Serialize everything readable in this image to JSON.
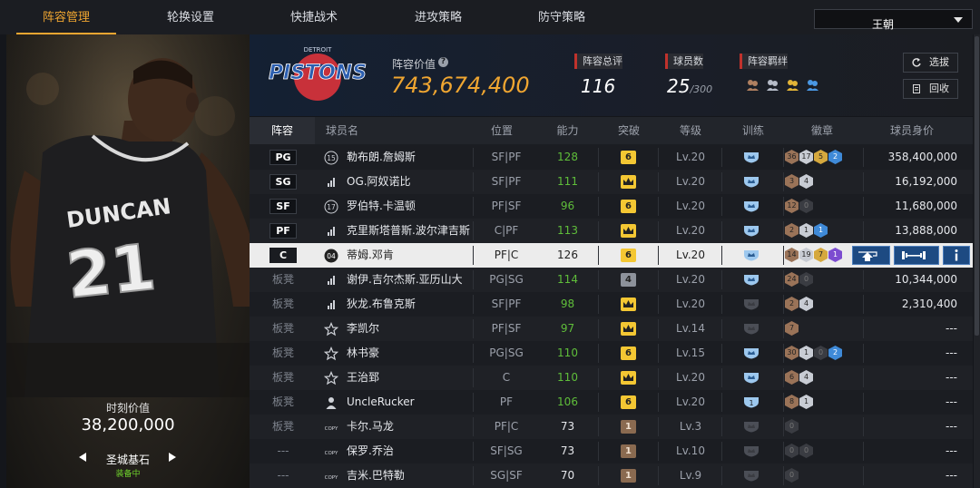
{
  "tabs": [
    "阵容管理",
    "轮换设置",
    "快捷战术",
    "进攻策略",
    "防守策略"
  ],
  "team_select": "王朝",
  "player_card": {
    "jersey_name": "DUNCAN",
    "jersey_number": "21",
    "moment_label": "时刻价值",
    "moment_value": "38,200,000",
    "card_name": "圣城基石",
    "card_status": "装备中"
  },
  "summary": {
    "team_logo_text": "PISTONS",
    "lineup_value_label": "阵容价值",
    "lineup_value": "743,674,400",
    "overall_label": "阵容总评",
    "overall_value": "116",
    "player_count_label": "球员数",
    "player_count": "25",
    "player_count_max": "/300",
    "bonds_label": "阵容羁绊",
    "scout_button": "选拔",
    "recycle_button": "回收"
  },
  "table": {
    "headers": [
      "阵容",
      "球员名",
      "位置",
      "能力",
      "突破",
      "等级",
      "训练",
      "徽章",
      "球员身价"
    ],
    "rows": [
      {
        "slot": "PG",
        "starter": true,
        "icon": "15",
        "name": "勒布朗.詹姆斯",
        "pos": "SF|PF",
        "ability": "128",
        "breakthrough": "6",
        "brk_type": "y",
        "level": "Lv.20",
        "train": "blue",
        "badges": [
          [
            "36",
            "br"
          ],
          [
            "17",
            "sv"
          ],
          [
            "5",
            "gd"
          ],
          [
            "2",
            "bl"
          ]
        ],
        "value": "358,400,000"
      },
      {
        "slot": "SG",
        "starter": true,
        "icon": "bars",
        "name": "OG.阿奴诺比",
        "pos": "SF|PF",
        "ability": "111",
        "breakthrough": "crown",
        "brk_type": "y",
        "level": "Lv.20",
        "train": "blue",
        "badges": [
          [
            "3",
            "br"
          ],
          [
            "4",
            "sv"
          ]
        ],
        "value": "16,192,000"
      },
      {
        "slot": "SF",
        "starter": true,
        "icon": "17",
        "name": "罗伯特.卡温顿",
        "pos": "PF|SF",
        "ability": "96",
        "breakthrough": "6",
        "brk_type": "y",
        "level": "Lv.20",
        "train": "blue",
        "badges": [
          [
            "12",
            "br"
          ],
          [
            "0",
            "dk"
          ]
        ],
        "value": "11,680,000"
      },
      {
        "slot": "PF",
        "starter": true,
        "icon": "bars",
        "name": "克里斯塔普斯.波尔津吉斯",
        "pos": "C|PF",
        "ability": "113",
        "breakthrough": "crown",
        "brk_type": "y",
        "level": "Lv.20",
        "train": "blue",
        "badges": [
          [
            "2",
            "br"
          ],
          [
            "1",
            "sv"
          ],
          [
            "1",
            "bl"
          ]
        ],
        "value": "13,888,000"
      },
      {
        "slot": "C",
        "starter": true,
        "selected": true,
        "icon": "04",
        "name": "蒂姆.邓肯",
        "pos": "PF|C",
        "ability": "126",
        "breakthrough": "6",
        "brk_type": "y",
        "level": "Lv.20",
        "train": "blue",
        "badges": [
          [
            "14",
            "br"
          ],
          [
            "19",
            "sv"
          ],
          [
            "7",
            "gd"
          ],
          [
            "1",
            "pu"
          ]
        ],
        "value": ""
      },
      {
        "slot": "板凳",
        "starter": false,
        "icon": "bars",
        "name": "谢伊.吉尔杰斯.亚历山大",
        "pos": "PG|SG",
        "ability": "114",
        "breakthrough": "4",
        "brk_type": "g",
        "level": "Lv.20",
        "train": "blue",
        "badges": [
          [
            "24",
            "br"
          ],
          [
            "0",
            "dk"
          ]
        ],
        "value": "10,344,000"
      },
      {
        "slot": "板凳",
        "starter": false,
        "icon": "bars",
        "name": "狄龙.布鲁克斯",
        "pos": "SF|PF",
        "ability": "98",
        "breakthrough": "crown",
        "brk_type": "y",
        "level": "Lv.20",
        "train": "dark",
        "badges": [
          [
            "2",
            "br"
          ],
          [
            "4",
            "sv"
          ]
        ],
        "value": "2,310,400"
      },
      {
        "slot": "板凳",
        "starter": false,
        "icon": "star",
        "name": "李凯尔",
        "pos": "PF|SF",
        "ability": "97",
        "breakthrough": "crown",
        "brk_type": "y",
        "level": "Lv.14",
        "train": "dark",
        "badges": [
          [
            "7",
            "br"
          ]
        ],
        "value": "---"
      },
      {
        "slot": "板凳",
        "starter": false,
        "icon": "star",
        "name": "林书豪",
        "pos": "PG|SG",
        "ability": "110",
        "breakthrough": "6",
        "brk_type": "y",
        "level": "Lv.15",
        "train": "blue",
        "badges": [
          [
            "30",
            "br"
          ],
          [
            "1",
            "sv"
          ],
          [
            "0",
            "dk"
          ],
          [
            "2",
            "bl"
          ]
        ],
        "value": "---"
      },
      {
        "slot": "板凳",
        "starter": false,
        "icon": "star",
        "name": "王治郅",
        "pos": "C",
        "ability": "110",
        "breakthrough": "crown",
        "brk_type": "y",
        "level": "Lv.20",
        "train": "blue",
        "badges": [
          [
            "6",
            "br"
          ],
          [
            "4",
            "sv"
          ]
        ],
        "value": "---"
      },
      {
        "slot": "板凳",
        "starter": false,
        "icon": "person",
        "name": "UncleRucker",
        "pos": "PF",
        "ability": "106",
        "breakthrough": "6",
        "brk_type": "y",
        "level": "Lv.20",
        "train": "blue1",
        "badges": [
          [
            "8",
            "br"
          ],
          [
            "1",
            "sv"
          ]
        ],
        "value": "---"
      },
      {
        "slot": "板凳",
        "starter": false,
        "icon": "COPY",
        "name": "卡尔.马龙",
        "pos": "PF|C",
        "ability": "73",
        "breakthrough": "1",
        "brk_type": "b",
        "level": "Lv.3",
        "train": "dark",
        "badges": [
          [
            "0",
            "dk"
          ]
        ],
        "value": "---"
      },
      {
        "slot": "---",
        "starter": false,
        "icon": "COPY",
        "name": "保罗.乔治",
        "pos": "SF|SG",
        "ability": "73",
        "breakthrough": "1",
        "brk_type": "b",
        "level": "Lv.10",
        "train": "dark",
        "badges": [
          [
            "0",
            "dk"
          ],
          [
            "0",
            "dk"
          ]
        ],
        "value": "---"
      },
      {
        "slot": "---",
        "starter": false,
        "icon": "COPY",
        "name": "吉米.巴特勒",
        "pos": "SG|SF",
        "ability": "70",
        "breakthrough": "1",
        "brk_type": "b",
        "level": "Lv.9",
        "train": "dark",
        "badges": [
          [
            "0",
            "dk"
          ]
        ],
        "value": "---"
      }
    ]
  },
  "colors": {
    "accent": "#f0a631",
    "ability_green": "#5fbe3a",
    "action_blue": "#1d4a82"
  }
}
